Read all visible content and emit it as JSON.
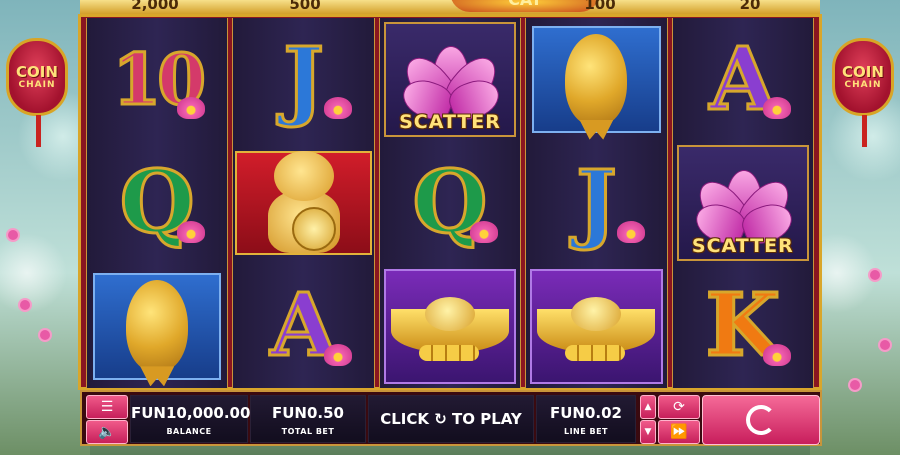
{
  "paytable": {
    "values": [
      "2,000",
      "500",
      "100",
      "20"
    ],
    "title": "CAT"
  },
  "lanterns": {
    "left": {
      "line1": "COIN",
      "line2": "CHAIN"
    },
    "right": {
      "line1": "COIN",
      "line2": "CHAIN"
    }
  },
  "reels": [
    [
      {
        "symbol": "10",
        "type": "royal",
        "color": "red"
      },
      {
        "symbol": "Q",
        "type": "royal",
        "color": "green"
      },
      {
        "symbol": "koi-fish",
        "type": "fish"
      }
    ],
    [
      {
        "symbol": "J",
        "type": "royal",
        "color": "blue"
      },
      {
        "symbol": "lucky-cat",
        "type": "cat"
      },
      {
        "symbol": "A",
        "type": "royal",
        "color": "purple"
      }
    ],
    [
      {
        "symbol": "SCATTER",
        "type": "scatter"
      },
      {
        "symbol": "Q",
        "type": "royal",
        "color": "green"
      },
      {
        "symbol": "gold-ingot",
        "type": "ingot"
      }
    ],
    [
      {
        "symbol": "koi-fish",
        "type": "fish"
      },
      {
        "symbol": "J",
        "type": "royal",
        "color": "blue"
      },
      {
        "symbol": "gold-ingot",
        "type": "ingot"
      }
    ],
    [
      {
        "symbol": "A",
        "type": "royal",
        "color": "purple"
      },
      {
        "symbol": "SCATTER",
        "type": "scatter"
      },
      {
        "symbol": "K",
        "type": "royal",
        "color": "orange"
      }
    ]
  ],
  "scatter_label": "SCATTER",
  "controls": {
    "balance_value": "FUN10,000.00",
    "balance_label": "BALANCE",
    "total_bet_value": "FUN0.50",
    "total_bet_label": "TOTAL BET",
    "play_label": "CLICK ↻ TO PLAY",
    "line_bet_value": "FUN0.02",
    "line_bet_label": "LINE BET",
    "menu_icon": "menu-icon",
    "sound_icon": "speaker-icon",
    "autoplay_icon": "autoplay-icon",
    "turbo_icon": "fast-forward-icon",
    "spin_icon": "spin-icon"
  },
  "colors": {
    "frame_red": "#8a1620",
    "gold": "#d9a62a",
    "button_pink": "#e03a72",
    "reel_bg": "#2a2150"
  }
}
